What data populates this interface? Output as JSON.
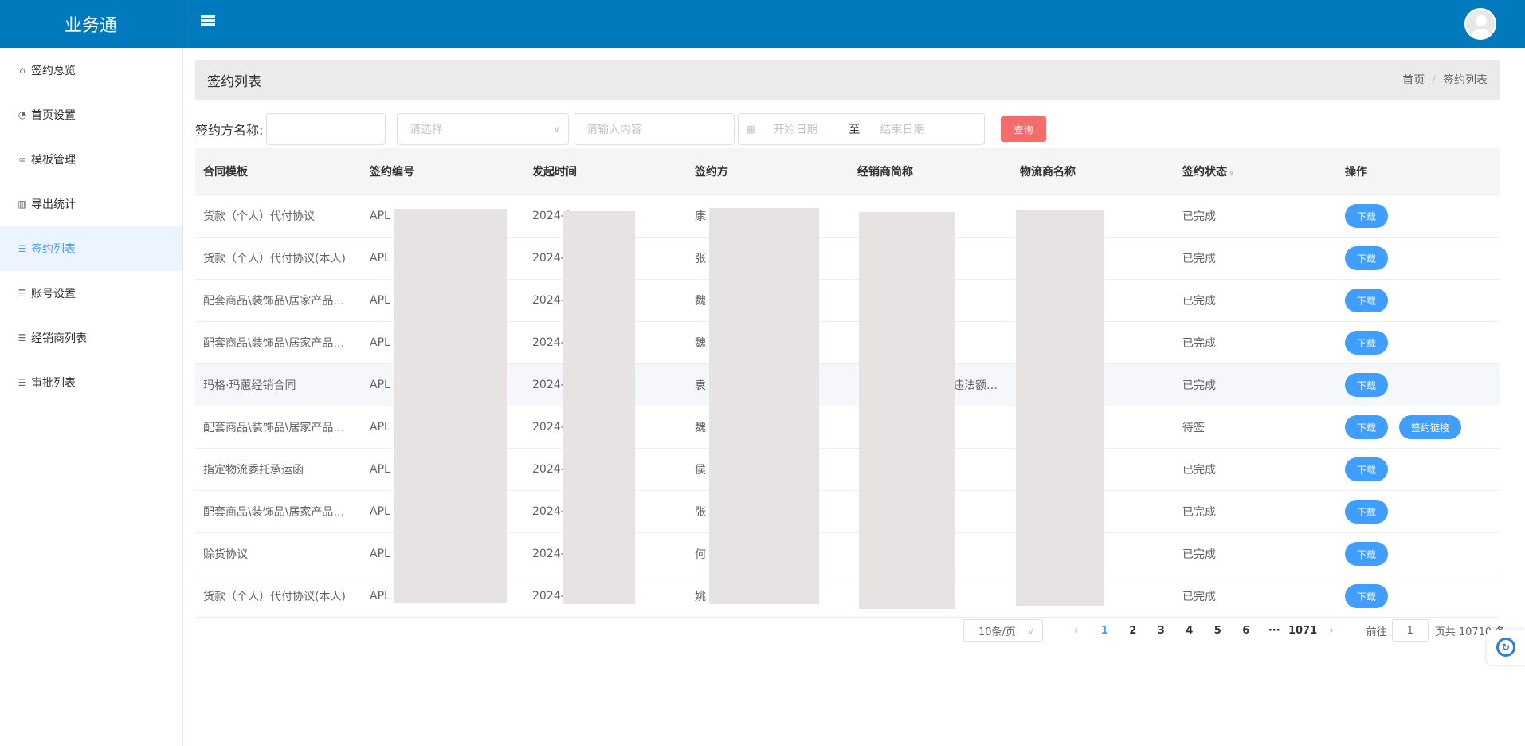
{
  "app": {
    "title": "业务通"
  },
  "sidebar": {
    "items": [
      {
        "label": "签约总览",
        "icon": "home-icon",
        "glyph": "⌂"
      },
      {
        "label": "首页设置",
        "icon": "dashboard-icon",
        "glyph": "◔"
      },
      {
        "label": "模板管理",
        "icon": "link-icon",
        "glyph": "∞"
      },
      {
        "label": "导出统计",
        "icon": "bar-chart-icon",
        "glyph": "▥"
      },
      {
        "label": "签约列表",
        "icon": "list-icon",
        "glyph": "☰"
      },
      {
        "label": "账号设置",
        "icon": "list-icon",
        "glyph": "☰"
      },
      {
        "label": "经销商列表",
        "icon": "list-icon",
        "glyph": "☰"
      },
      {
        "label": "审批列表",
        "icon": "list-icon",
        "glyph": "☰"
      }
    ],
    "active_index": 4
  },
  "page": {
    "title": "签约列表",
    "breadcrumb": [
      "首页",
      "签约列表"
    ],
    "breadcrumb_sep": "/"
  },
  "filters": {
    "name_label": "签约方名称:",
    "name_value": "",
    "select_placeholder": "请选择",
    "content_placeholder": "请输入内容",
    "start_placeholder": "开始日期",
    "date_sep": "至",
    "end_placeholder": "结束日期",
    "query_label": "查询"
  },
  "table": {
    "columns": [
      "合同模板",
      "签约编号",
      "发起时间",
      "签约方",
      "经销商简称",
      "物流商名称",
      "签约状态",
      "操作"
    ],
    "rows": [
      {
        "template": "货款（个人）代付协议",
        "code": "APL",
        "time": "2024-0",
        "party": "康",
        "dealer": "",
        "logistics": "",
        "status": "已完成"
      },
      {
        "template": "货款（个人）代付协议(本人)",
        "code": "APL",
        "time": "2024-0",
        "party": "张",
        "dealer": "",
        "logistics": "",
        "status": "已完成"
      },
      {
        "template": "配套商品\\装饰品\\居家产品…",
        "code": "APL",
        "time": "2024-0",
        "party": "魏",
        "dealer": "",
        "logistics": "",
        "status": "已完成"
      },
      {
        "template": "配套商品\\装饰品\\居家产品…",
        "code": "APL",
        "time": "2024-0",
        "party": "魏",
        "dealer": "",
        "logistics": "",
        "status": "已完成"
      },
      {
        "template": "玛格·玛蕙经销合同",
        "code": "APL",
        "time": "2024-0",
        "party": "袁",
        "dealer": "违法额…",
        "logistics": "",
        "status": "已完成"
      },
      {
        "template": "配套商品\\装饰品\\居家产品…",
        "code": "APL",
        "time": "2024-0",
        "party": "魏",
        "dealer": "",
        "logistics": "",
        "status": "待签"
      },
      {
        "template": "指定物流委托承运函",
        "code": "APL",
        "time": "2024-0",
        "party": "侯",
        "dealer": "",
        "logistics": "",
        "status": "已完成"
      },
      {
        "template": "配套商品\\装饰品\\居家产品…",
        "code": "APL",
        "time": "2024-0",
        "party": "张",
        "dealer": "",
        "logistics": "",
        "status": "已完成"
      },
      {
        "template": "赊货协议",
        "code": "APL",
        "time": "2024-0",
        "party": "何",
        "dealer": "",
        "logistics": "",
        "status": "已完成"
      },
      {
        "template": "货款（个人）代付协议(本人)",
        "code": "APL",
        "time": "2024-0",
        "party": "姚",
        "dealer": "",
        "logistics": "",
        "status": "已完成"
      }
    ],
    "download_label": "下载",
    "link_label": "签约链接"
  },
  "pagination": {
    "page_size": "10条/页",
    "pages": [
      "1",
      "2",
      "3",
      "4",
      "5",
      "6",
      "···",
      "1071"
    ],
    "current": "1",
    "goto_label": "前往",
    "goto_value": "1",
    "total_label": "页共 10710 条"
  },
  "colors": {
    "header": "#0079bd",
    "accent": "#409eff",
    "query": "#f56c6c"
  }
}
